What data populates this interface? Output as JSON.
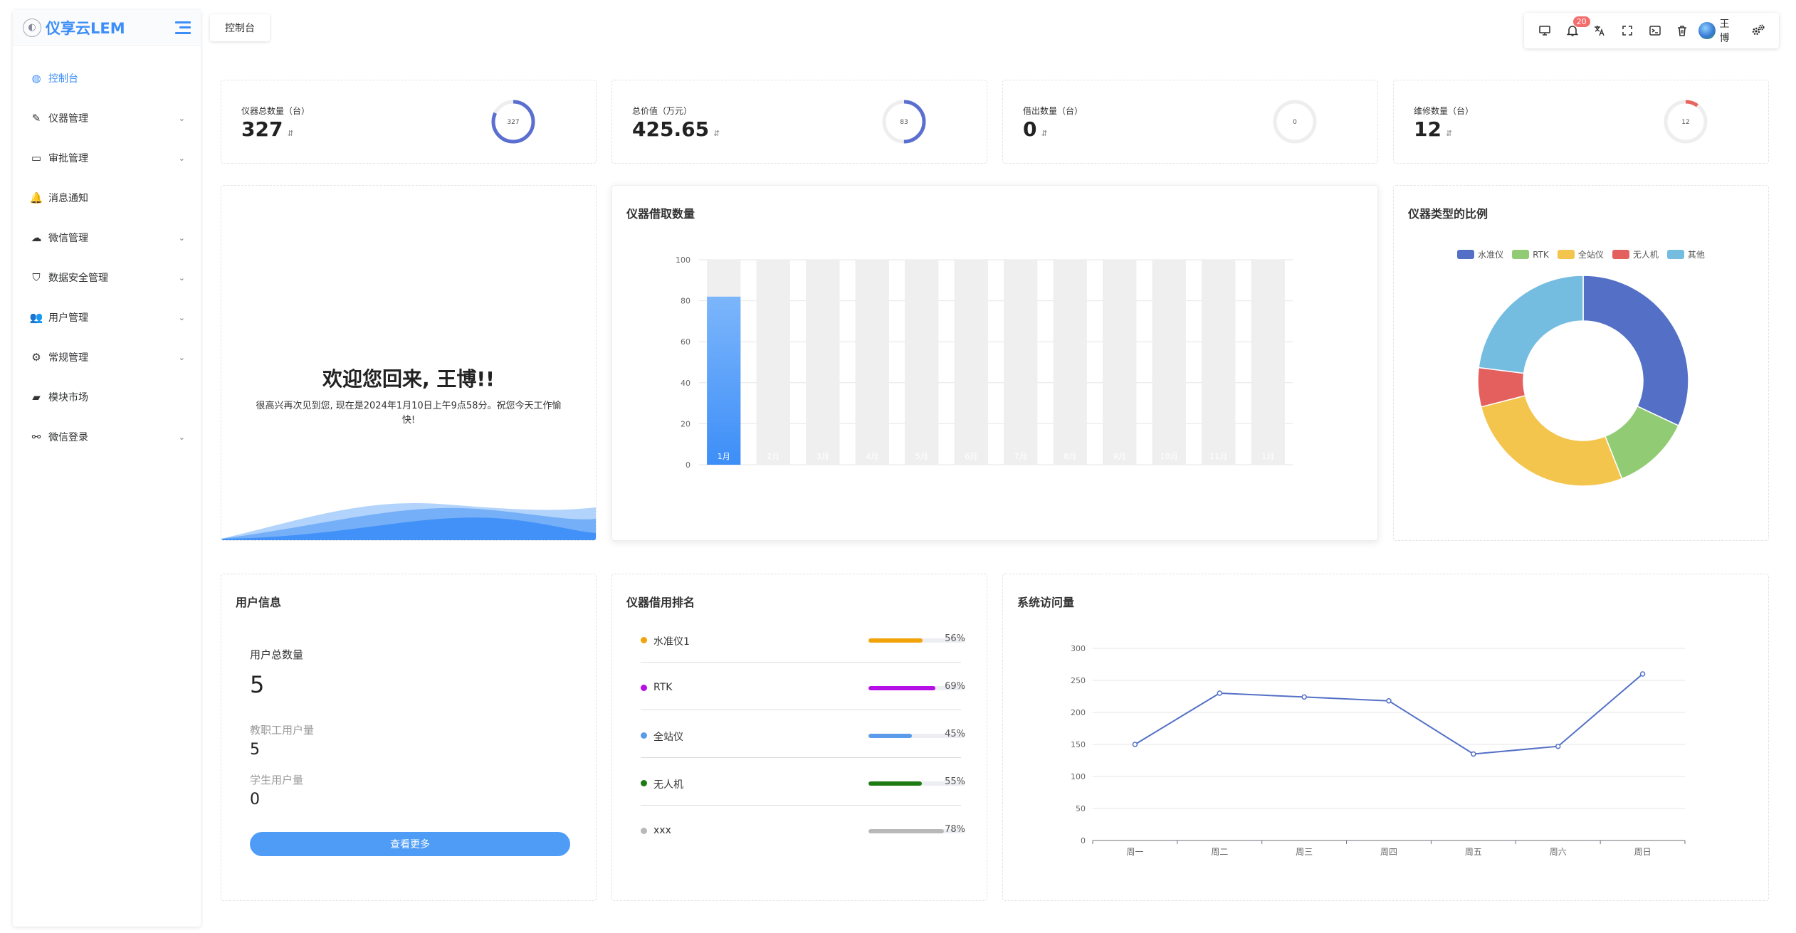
{
  "app": {
    "name": "仪享云LEM"
  },
  "sidebar": {
    "items": [
      {
        "label": "控制台",
        "icon": "dashboard-icon",
        "active": true,
        "has_children": false
      },
      {
        "label": "仪器管理",
        "icon": "wand-icon",
        "has_children": true
      },
      {
        "label": "审批管理",
        "icon": "comment-icon",
        "has_children": true
      },
      {
        "label": "消息通知",
        "icon": "bell-icon",
        "has_children": false
      },
      {
        "label": "微信管理",
        "icon": "wechat-icon",
        "has_children": true
      },
      {
        "label": "数据安全管理",
        "icon": "shield-icon",
        "has_children": true
      },
      {
        "label": "用户管理",
        "icon": "users-icon",
        "has_children": true
      },
      {
        "label": "常规管理",
        "icon": "gears-icon",
        "has_children": true
      },
      {
        "label": "模块市场",
        "icon": "shopping-bag-icon",
        "has_children": false
      },
      {
        "label": "微信登录",
        "icon": "handshake-icon",
        "has_children": true
      }
    ]
  },
  "header": {
    "tab": "控制台",
    "notification_count": "20",
    "user_name": "王博"
  },
  "stats": [
    {
      "label": "仪器总数量（台）",
      "value": "327",
      "ring_label": "327",
      "ring_fraction": 0.82,
      "ring_color": "#5b6fd0"
    },
    {
      "label": "总价值（万元）",
      "value": "425.65",
      "ring_label": "83",
      "ring_fraction": 0.5,
      "ring_color": "#5b6fd0"
    },
    {
      "label": "借出数量（台）",
      "value": "0",
      "ring_label": "0",
      "ring_fraction": 0.0,
      "ring_color": "#5b6fd0"
    },
    {
      "label": "维修数量（台）",
      "value": "12",
      "ring_label": "12",
      "ring_fraction": 0.1,
      "ring_color": "#e8655e"
    }
  ],
  "welcome": {
    "title": "欢迎您回来, 王博!!",
    "text": "很高兴再次见到您, 现在是2024年1月10日上午9点58分。祝您今天工作愉快!"
  },
  "borrow_chart": {
    "title": "仪器借取数量",
    "chart_data": {
      "type": "bar",
      "categories": [
        "1月",
        "2月",
        "3月",
        "4月",
        "5月",
        "6月",
        "7月",
        "8月",
        "9月",
        "10月",
        "11月",
        "1月"
      ],
      "values": [
        82,
        0,
        0,
        0,
        0,
        0,
        0,
        0,
        0,
        0,
        0,
        0
      ],
      "background_max": 100,
      "ylim": [
        0,
        100
      ],
      "yticks": [
        0,
        20,
        40,
        60,
        80,
        100
      ],
      "grid": true,
      "colors": {
        "bar": "#3d8ef8",
        "bar_top": "#7cb6fb",
        "background": "#efefef"
      }
    }
  },
  "pie_chart": {
    "title": "仪器类型的比例",
    "chart_data": {
      "type": "pie",
      "categories": [
        "水准仪",
        "RTK",
        "全站仪",
        "无人机",
        "其他"
      ],
      "values": [
        32,
        12,
        27,
        6,
        23
      ],
      "colors": [
        "#5470c6",
        "#91cc75",
        "#f4c54d",
        "#e4605f",
        "#74bde0"
      ],
      "legend": "top"
    }
  },
  "user_info": {
    "title": "用户信息",
    "total_label": "用户总数量",
    "total_value": "5",
    "staff_label": "教职工用户量",
    "staff_value": "5",
    "student_label": "学生用户量",
    "student_value": "0",
    "more_button": "查看更多"
  },
  "ranking": {
    "title": "仪器借用排名",
    "items": [
      {
        "name": "水准仪1",
        "percent": 56,
        "percent_label": "56%",
        "color": "#f1a30a"
      },
      {
        "name": "RTK",
        "percent": 69,
        "percent_label": "69%",
        "color": "#b60ee6"
      },
      {
        "name": "全站仪",
        "percent": 45,
        "percent_label": "45%",
        "color": "#5b9bea"
      },
      {
        "name": "无人机",
        "percent": 55,
        "percent_label": "55%",
        "color": "#1e7a13"
      },
      {
        "name": "xxx",
        "percent": 78,
        "percent_label": "78%",
        "color": "#b8b8b8"
      }
    ]
  },
  "visits_chart": {
    "title": "系统访问量",
    "chart_data": {
      "type": "line",
      "categories": [
        "周一",
        "周二",
        "周三",
        "周四",
        "周五",
        "周六",
        "周日"
      ],
      "values": [
        150,
        230,
        224,
        218,
        135,
        147,
        260
      ],
      "ylim": [
        0,
        300
      ],
      "yticks": [
        0,
        50,
        100,
        150,
        200,
        250,
        300
      ],
      "grid": true,
      "colors": {
        "line": "#5470c6"
      }
    }
  }
}
